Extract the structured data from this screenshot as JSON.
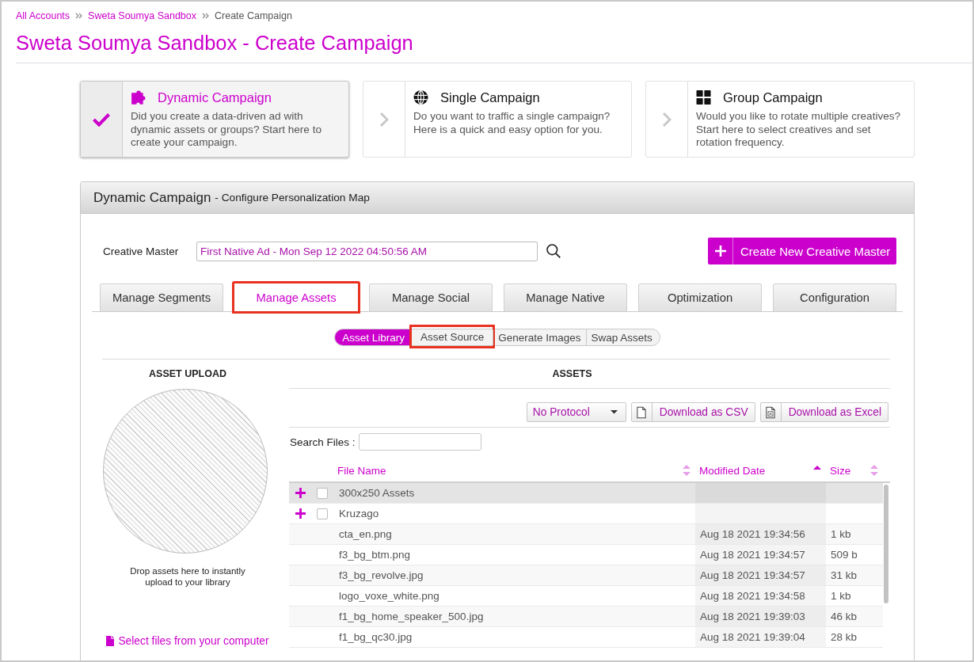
{
  "breadcrumb": [
    {
      "label": "All Accounts",
      "kind": "link"
    },
    {
      "label": "Sweta Soumya Sandbox",
      "kind": "link"
    },
    {
      "label": "Create Campaign",
      "kind": "current"
    }
  ],
  "page_title": "Sweta Soumya Sandbox - Create Campaign",
  "campaign_types": [
    {
      "kind": "dynamic",
      "title": "Dynamic Campaign",
      "description": "Did you create a data-driven ad with dynamic assets or groups? Start here to create your campaign.",
      "selected": true
    },
    {
      "kind": "single",
      "title": "Single Campaign",
      "description": "Do you want to traffic a single campaign? Here is a quick and easy option for you.",
      "selected": false
    },
    {
      "kind": "group",
      "title": "Group Campaign",
      "description": "Would you like to rotate multiple creatives? Start here to select creatives and set rotation frequency.",
      "selected": false
    }
  ],
  "panel": {
    "title": "Dynamic Campaign",
    "subtitle": "- Configure Personalization Map"
  },
  "creative_master": {
    "label": "Creative Master",
    "value": "First Native Ad - Mon Sep 12 2022 04:50:56 AM"
  },
  "create_button": {
    "label": "Create New Creative Master"
  },
  "tabs": [
    {
      "label": "Manage Segments",
      "selected": false,
      "highlighted": false
    },
    {
      "label": "Manage Assets",
      "selected": true,
      "highlighted": true
    },
    {
      "label": "Manage Social",
      "selected": false,
      "highlighted": false
    },
    {
      "label": "Manage Native",
      "selected": false,
      "highlighted": false
    },
    {
      "label": "Optimization",
      "selected": false,
      "highlighted": false
    },
    {
      "label": "Configuration",
      "selected": false,
      "highlighted": false
    }
  ],
  "subtabs": [
    {
      "label": "Asset Library",
      "selected": true,
      "highlighted": false
    },
    {
      "label": "Asset Source",
      "selected": false,
      "highlighted": true
    },
    {
      "label": "Generate Images",
      "selected": false,
      "highlighted": false
    },
    {
      "label": "Swap Assets",
      "selected": false,
      "highlighted": false
    }
  ],
  "asset_upload": {
    "title": "ASSET UPLOAD",
    "drop_text": "Drop assets here to instantly upload to your library",
    "select_link": "Select files from your computer"
  },
  "assets": {
    "title": "ASSETS",
    "protocol": "No Protocol",
    "download_buttons": [
      {
        "kind": "csv",
        "label": "Download as CSV"
      },
      {
        "kind": "excel",
        "label": "Download as Excel"
      }
    ],
    "search_label": "Search Files :",
    "table": {
      "columns": [
        {
          "label": "File Name",
          "sorted": false
        },
        {
          "label": "Modified Date",
          "sorted": true
        },
        {
          "label": "Size",
          "sorted": false
        }
      ],
      "rows": [
        {
          "kind": "folder",
          "name": "300x250 Assets",
          "selected": true,
          "checked": false,
          "expanded": false
        },
        {
          "kind": "folder",
          "name": "Kruzago",
          "selected": false,
          "checked": false,
          "expanded": false
        },
        {
          "kind": "file",
          "name": "cta_en.png",
          "modified": "Aug 18 2021 19:34:56",
          "size": "1 kb",
          "selected": false
        },
        {
          "kind": "file",
          "name": "f3_bg_btm.png",
          "modified": "Aug 18 2021 19:34:57",
          "size": "509 b",
          "selected": false
        },
        {
          "kind": "file",
          "name": "f3_bg_revolve.jpg",
          "modified": "Aug 18 2021 19:34:57",
          "size": "31 kb",
          "selected": false
        },
        {
          "kind": "file",
          "name": "logo_voxe_white.png",
          "modified": "Aug 18 2021 19:34:58",
          "size": "1 kb",
          "selected": false
        },
        {
          "kind": "file",
          "name": "f1_bg_home_speaker_500.jpg",
          "modified": "Aug 18 2021 19:39:03",
          "size": "46 kb",
          "selected": false
        },
        {
          "kind": "file",
          "name": "f1_bg_qc30.jpg",
          "modified": "Aug 18 2021 19:39:04",
          "size": "28 kb",
          "selected": false
        }
      ]
    }
  }
}
